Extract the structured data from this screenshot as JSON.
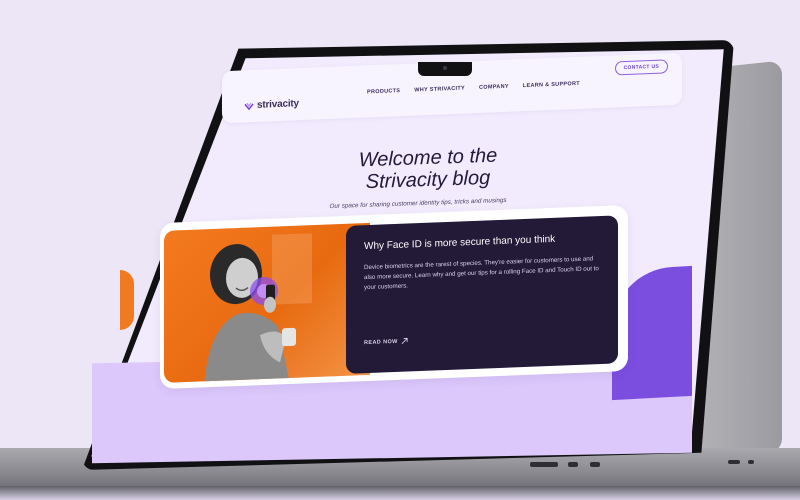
{
  "site": {
    "logo_text": "strivacity",
    "nav": [
      {
        "label": "PRODUCTS"
      },
      {
        "label": "WHY STRIVACITY"
      },
      {
        "label": "COMPANY"
      },
      {
        "label": "LEARN & SUPPORT"
      }
    ],
    "contact_label": "CONTACT US"
  },
  "hero": {
    "title_line1": "Welcome to the",
    "title_line2": "Strivacity blog",
    "subtitle": "Our space for sharing customer identity tips, tricks and musings"
  },
  "featured_post": {
    "title": "Why Face ID is more secure than you think",
    "body": "Device biometrics are the rarest of species. They're easier for customers to use and also more secure. Learn why and get our tips for a rolling Face ID and Touch ID out to your customers.",
    "cta": "READ NOW"
  },
  "colors": {
    "accent": "#6b3fd3",
    "dark_card": "#231a38",
    "photo_orange": "#f47a1f",
    "lilac": "#dcc8fb",
    "background": "#ece6f7"
  },
  "icons": [
    "strivacity-logo-icon",
    "arrow-up-right-icon"
  ]
}
